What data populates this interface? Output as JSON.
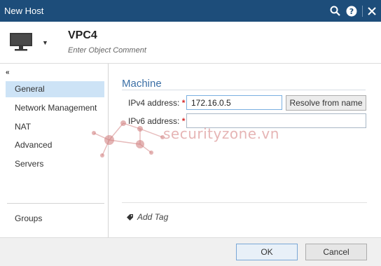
{
  "window": {
    "title": "New Host"
  },
  "header": {
    "object_name": "VPC4",
    "comment_placeholder": "Enter Object Comment"
  },
  "sidebar": {
    "collapse_glyph": "«",
    "items": [
      {
        "label": "General"
      },
      {
        "label": "Network Management"
      },
      {
        "label": "NAT"
      },
      {
        "label": "Advanced"
      },
      {
        "label": "Servers"
      }
    ],
    "groups_label": "Groups"
  },
  "machine": {
    "section_title": "Machine",
    "ipv4_label": "IPv4 address:",
    "ipv4_value": "172.16.0.5",
    "ipv6_label": "IPv6 address:",
    "ipv6_value": "",
    "required_mark": "*",
    "resolve_label": "Resolve from name"
  },
  "tags": {
    "add_tag_label": "Add Tag"
  },
  "footer": {
    "ok_label": "OK",
    "cancel_label": "Cancel"
  },
  "watermark": {
    "text": "securityzone.vn"
  },
  "colors": {
    "titlebar": "#1d4d7a",
    "accent": "#3b6fa6",
    "selected_nav": "#cde3f6",
    "required": "#d62e2e"
  }
}
